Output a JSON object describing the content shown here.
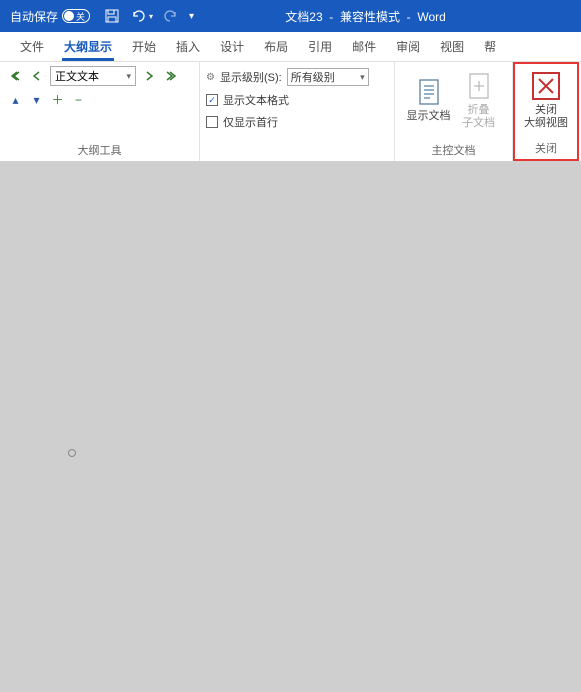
{
  "titlebar": {
    "autosave": "自动保存",
    "autosave_state": "关",
    "doc": "文档23",
    "sep": "-",
    "compat": "兼容性模式",
    "app": "Word"
  },
  "tabs": {
    "file": "文件",
    "outline": "大纲显示",
    "home": "开始",
    "insert": "插入",
    "design": "设计",
    "layout": "布局",
    "references": "引用",
    "mailings": "邮件",
    "review": "审阅",
    "view": "视图",
    "help": "帮"
  },
  "ribbon": {
    "outlineTools": {
      "level_value": "正文文本",
      "showlevel_label": "显示级别(S):",
      "showlevel_value": "所有级别",
      "show_fmt": "显示文本格式",
      "first_line": "仅显示首行",
      "group": "大纲工具"
    },
    "master": {
      "showdoc": "显示文档",
      "collapse": "折叠",
      "subdocs": "子文档",
      "group": "主控文档"
    },
    "close": {
      "line1": "关闭",
      "line2": "大纲视图",
      "group": "关闭"
    }
  }
}
